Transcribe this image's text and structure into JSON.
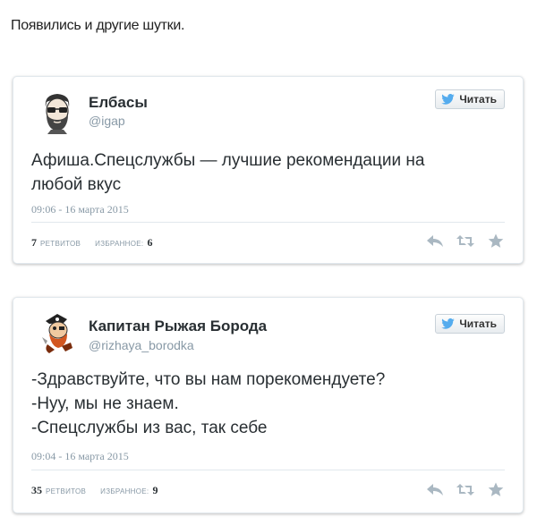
{
  "intro_text": "Появились и другие шутки.",
  "follow_label": "Читать",
  "tweets": [
    {
      "name": "Елбасы",
      "handle": "@igap",
      "lines": [
        "Афиша.Спецслужбы — лучшие рекомендации на",
        "любой вкус"
      ],
      "date": "09:06 - 16 марта 2015",
      "retweets": "7",
      "retweets_label": "РЕТВИТОВ",
      "favorites_label": "ИЗБРАННОЕ:",
      "favorites": "6"
    },
    {
      "name": "Капитан Рыжая Борода",
      "handle": "@rizhaya_borodka",
      "lines": [
        "-Здравствуйте, что вы нам порекомендуете?",
        "-Нуу, мы не знаем.",
        "-Спецслужбы из вас, так себе"
      ],
      "date": "09:04 - 16 марта 2015",
      "retweets": "35",
      "retweets_label": "РЕТВИТОВ",
      "favorites_label": "ИЗБРАННОЕ:",
      "favorites": "9"
    }
  ],
  "icons": {
    "bird": "twitter-bird-icon",
    "reply": "reply-icon",
    "retweet": "retweet-icon",
    "favorite": "star-icon"
  },
  "colors": {
    "twitter_blue": "#55acee",
    "meta_gray": "#8899a6",
    "action_gray": "#aab8c2"
  }
}
